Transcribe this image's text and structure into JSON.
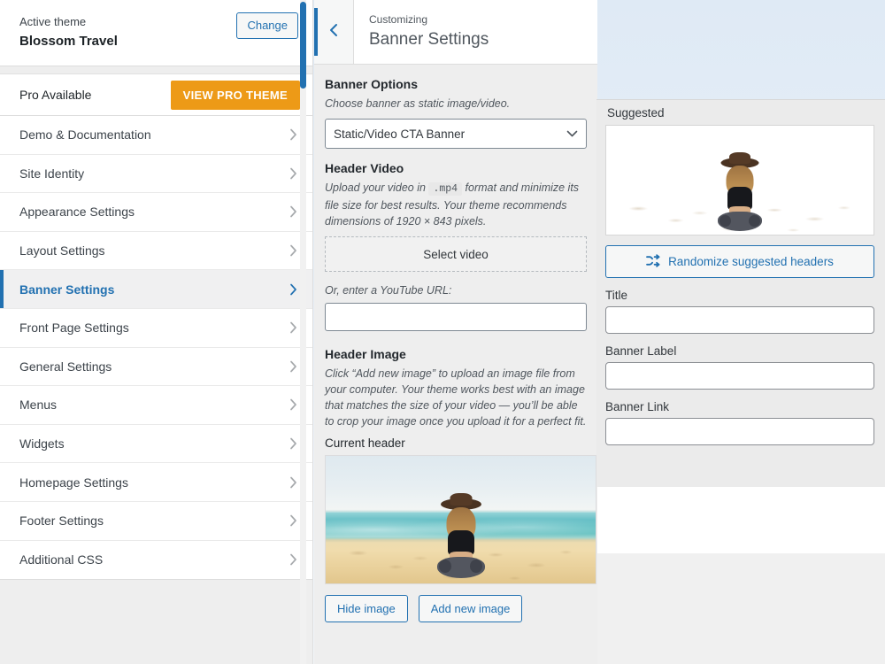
{
  "sidebar": {
    "theme": {
      "active_label": "Active theme",
      "name": "Blossom Travel",
      "change_label": "Change"
    },
    "pro": {
      "label": "Pro Available",
      "button_label": "VIEW PRO THEME"
    },
    "items": [
      {
        "label": "Demo & Documentation",
        "active": false
      },
      {
        "label": "Site Identity",
        "active": false
      },
      {
        "label": "Appearance Settings",
        "active": false
      },
      {
        "label": "Layout Settings",
        "active": false
      },
      {
        "label": "Banner Settings",
        "active": true
      },
      {
        "label": "Front Page Settings",
        "active": false
      },
      {
        "label": "General Settings",
        "active": false
      },
      {
        "label": "Menus",
        "active": false
      },
      {
        "label": "Widgets",
        "active": false
      },
      {
        "label": "Homepage Settings",
        "active": false
      },
      {
        "label": "Footer Settings",
        "active": false
      },
      {
        "label": "Additional CSS",
        "active": false
      }
    ]
  },
  "section": {
    "header": {
      "eyebrow": "Customizing",
      "title": "Banner Settings",
      "back_icon": "chevron-left-icon"
    },
    "banner_options": {
      "title": "Banner Options",
      "description": "Choose banner as static image/video.",
      "select_value": "Static/Video CTA Banner",
      "select_options": [
        "Static/Video CTA Banner"
      ]
    },
    "header_video": {
      "title": "Header Video",
      "desc_part1": "Upload your video in",
      "desc_code": ".mp4",
      "desc_part2": "format and minimize its file size for best results. Your theme recommends dimensions of 1920 × 843 pixels.",
      "select_video_label": "Select video",
      "youtube_label": "Or, enter a YouTube URL:",
      "youtube_value": "",
      "youtube_placeholder": ""
    },
    "header_image": {
      "title": "Header Image",
      "description": "Click “Add new image” to upload an image file from your computer. Your theme works best with an image that matches the size of your video — you’ll be able to crop your image once you upload it for a perfect fit.",
      "current_header_label": "Current header",
      "current_header_alt": "beach-header-image",
      "hide_image_label": "Hide image",
      "add_new_image_label": "Add new image"
    }
  },
  "right_panel": {
    "suggested_label": "Suggested",
    "suggested_image_alt": "beach-suggested-image",
    "randomize_label": "Randomize suggested headers",
    "randomize_icon": "shuffle-icon",
    "fields": [
      {
        "label": "Title",
        "value": "",
        "placeholder": ""
      },
      {
        "label": "Banner Label",
        "value": "",
        "placeholder": ""
      },
      {
        "label": "Banner Link",
        "value": "",
        "placeholder": ""
      }
    ]
  },
  "colors": {
    "accent_blue": "#2271b1",
    "pro_orange": "#ed9a17",
    "sidebar_bg": "#eeeeee",
    "panel_bg": "#ebebeb"
  }
}
